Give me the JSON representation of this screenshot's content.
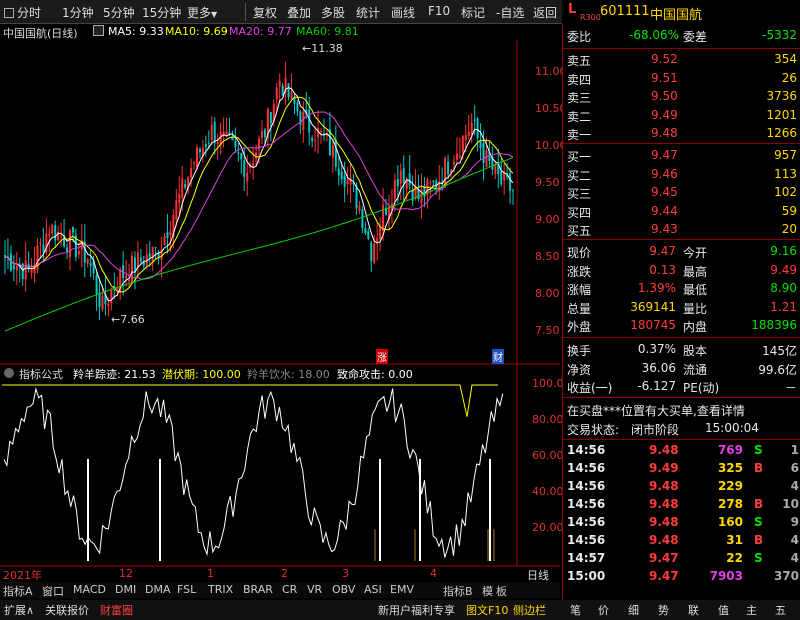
{
  "toolbar": {
    "items": [
      "分时",
      "1分钟",
      "5分钟",
      "15分钟",
      "更多"
    ],
    "more_arrow": "▼",
    "right": [
      "复权",
      "叠加",
      "多股",
      "统计",
      "画线",
      "F10",
      "标记",
      "-自选",
      "返回"
    ]
  },
  "stock_header": {
    "badge_top": "L",
    "badge_bot": "R300",
    "code": "601111",
    "name": "中国国航"
  },
  "chart": {
    "title_name": "中国国航(日线)",
    "ma5": "MA5: 9.33",
    "ma10": "MA10: 9.69",
    "ma20": "MA20: 9.77",
    "ma60": "MA60: 9.81",
    "high_label": "11.38",
    "low_label": "7.66",
    "yaxis": [
      "11.00",
      "10.50",
      "10.00",
      "9.50",
      "9.00",
      "8.50",
      "8.00",
      "7.50"
    ],
    "marks": {
      "zhang": "涨",
      "cai": "财"
    },
    "xaxis": [
      "2021年",
      "12",
      "1",
      "2",
      "3",
      "4"
    ],
    "colors": {
      "ma5": "#ffffff",
      "ma10": "#ffff00",
      "ma20": "#e040e0",
      "ma60": "#00d000",
      "up": "#ff3232",
      "down": "#00c8c8"
    }
  },
  "indicator": {
    "title": "指标公式",
    "l1": "羚羊踪迹: 21.53",
    "l2": "潜伏期: 100.00",
    "l3": "羚羊饮水: 18.00",
    "l4": "致命攻击: 0.00",
    "yaxis": [
      "100.0",
      "80.00",
      "60.00",
      "40.00",
      "20.00"
    ],
    "day_label": "日线"
  },
  "bottom_tabs": [
    "指标A",
    "窗口",
    "MACD",
    "DMI",
    "DMA",
    "FSL",
    "TRIX",
    "BRAR",
    "CR",
    "VR",
    "OBV",
    "ASI",
    "EMV",
    "指标B",
    "模",
    "板"
  ],
  "bottom_bar": {
    "left": [
      "扩展∧",
      "关联报价",
      "财富圈"
    ],
    "mid": [
      "新用户福利专享",
      "图文F10",
      "侧边栏"
    ],
    "icons": [
      "笔",
      "价",
      "细",
      "势",
      "联",
      "值",
      "主",
      "五"
    ]
  },
  "quote": {
    "weibi_label": "委比",
    "weibi": "-68.06%",
    "weicha_label": "委差",
    "weicha": "-5332",
    "asks": [
      {
        "label": "卖五",
        "price": "9.52",
        "vol": "354"
      },
      {
        "label": "卖四",
        "price": "9.51",
        "vol": "26"
      },
      {
        "label": "卖三",
        "price": "9.50",
        "vol": "3736"
      },
      {
        "label": "卖二",
        "price": "9.49",
        "vol": "1201"
      },
      {
        "label": "卖一",
        "price": "9.48",
        "vol": "1266"
      }
    ],
    "bids": [
      {
        "label": "买一",
        "price": "9.47",
        "vol": "957"
      },
      {
        "label": "买二",
        "price": "9.46",
        "vol": "113"
      },
      {
        "label": "买三",
        "price": "9.45",
        "vol": "102"
      },
      {
        "label": "买四",
        "price": "9.44",
        "vol": "59"
      },
      {
        "label": "买五",
        "price": "9.43",
        "vol": "20"
      }
    ],
    "stats": [
      {
        "l1": "现价",
        "v1": "9.47",
        "l2": "今开",
        "v2": "9.16"
      },
      {
        "l1": "涨跌",
        "v1": "0.13",
        "l2": "最高",
        "v2": "9.49"
      },
      {
        "l1": "涨幅",
        "v1": "1.39%",
        "l2": "最低",
        "v2": "8.90"
      },
      {
        "l1": "总量",
        "v1": "369141",
        "l2": "量比",
        "v2": "1.21"
      },
      {
        "l1": "外盘",
        "v1": "180745",
        "l2": "内盘",
        "v2": "188396"
      }
    ],
    "stats2": [
      {
        "l1": "换手",
        "v1": "0.37%",
        "l2": "股本",
        "v2": "145亿"
      },
      {
        "l1": "净资",
        "v1": "36.06",
        "l2": "流通",
        "v2": "99.6亿"
      },
      {
        "l1": "收益(一)",
        "v1": "-6.127",
        "l2": "PE(动)",
        "v2": "－"
      }
    ],
    "notice": "在买盘***位置有大买单,查看详情",
    "status_label": "交易状态:",
    "status": "闭市阶段",
    "status_time": "15:00:04",
    "ticks": [
      {
        "t": "14:56",
        "p": "9.48",
        "v": "769",
        "s": "S",
        "x": "1"
      },
      {
        "t": "14:56",
        "p": "9.49",
        "v": "325",
        "s": "B",
        "x": "6"
      },
      {
        "t": "14:56",
        "p": "9.48",
        "v": "229",
        "s": "",
        "x": "4"
      },
      {
        "t": "14:56",
        "p": "9.48",
        "v": "278",
        "s": "B",
        "x": "10"
      },
      {
        "t": "14:56",
        "p": "9.48",
        "v": "160",
        "s": "S",
        "x": "9"
      },
      {
        "t": "14:56",
        "p": "9.48",
        "v": "31",
        "s": "B",
        "x": "4"
      },
      {
        "t": "14:57",
        "p": "9.47",
        "v": "22",
        "s": "S",
        "x": "4"
      },
      {
        "t": "15:00",
        "p": "9.47",
        "v": "7903",
        "s": "",
        "x": "370"
      }
    ]
  }
}
